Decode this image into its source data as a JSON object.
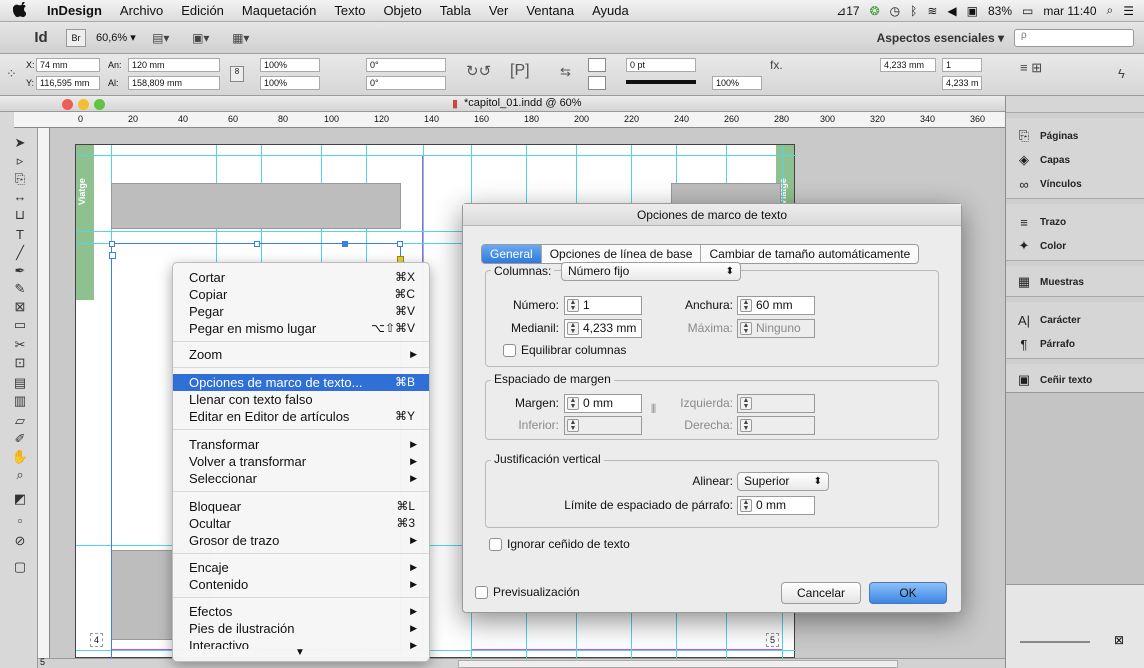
{
  "menubar": {
    "apple": "",
    "items": [
      "InDesign",
      "Archivo",
      "Edición",
      "Maquetación",
      "Texto",
      "Objeto",
      "Tabla",
      "Ver",
      "Ventana",
      "Ayuda"
    ],
    "status_badge": "17",
    "battery": "83%",
    "clock": "mar 11:40"
  },
  "appbar": {
    "logo": "Id",
    "bridge": "Br",
    "zoom": "60,6% ▾",
    "workspace": "Aspectos esenciales ▾",
    "search_placeholder": "ρ"
  },
  "control": {
    "x_label": "X:",
    "x_value": "74 mm",
    "y_label": "Y:",
    "y_value": "116,595 mm",
    "w_label": "An:",
    "w_value": "120 mm",
    "h_label": "Al:",
    "h_value": "158,809 mm",
    "scale_x": "100%",
    "scale_y": "100%",
    "angle": "0°",
    "shear": "0°",
    "stroke_weight": "0 pt",
    "opacity": "100%",
    "col_width": "4,233 mm",
    "columns": "1",
    "gutter": "4,233 m"
  },
  "document": {
    "tab_title": "*capitol_01.indd @ 60%",
    "ruler_ticks": [
      "0",
      "20",
      "40",
      "60",
      "80",
      "100",
      "120",
      "140",
      "160",
      "180",
      "200",
      "220",
      "240",
      "260",
      "280",
      "300",
      "320",
      "340",
      "360"
    ],
    "margin_label_left": "Viatge",
    "margin_label_right": "Viatge",
    "page_num_left": "4",
    "page_num_right": "5",
    "status_page": "5"
  },
  "panels": [
    {
      "icon": "pages-icon",
      "label": "Páginas"
    },
    {
      "icon": "layers-icon",
      "label": "Capas"
    },
    {
      "icon": "links-icon",
      "label": "Vínculos"
    },
    {
      "icon": "stroke-icon",
      "label": "Trazo"
    },
    {
      "icon": "color-icon",
      "label": "Color"
    },
    {
      "icon": "swatches-icon",
      "label": "Muestras"
    },
    {
      "icon": "character-icon",
      "label": "Carácter"
    },
    {
      "icon": "paragraph-icon",
      "label": "Párrafo"
    },
    {
      "icon": "text-wrap-icon",
      "label": "Ceñir texto"
    }
  ],
  "context_menu": {
    "items": [
      {
        "label": "Cortar",
        "shortcut": "⌘X"
      },
      {
        "label": "Copiar",
        "shortcut": "⌘C"
      },
      {
        "label": "Pegar",
        "shortcut": "⌘V"
      },
      {
        "label": "Pegar en mismo lugar",
        "shortcut": "⌥⇧⌘V"
      },
      {
        "label": "Zoom",
        "shortcut": "▶"
      },
      {
        "label": "Opciones de marco de texto...",
        "shortcut": "⌘B"
      },
      {
        "label": "Llenar con texto falso",
        "shortcut": ""
      },
      {
        "label": "Editar en Editor de artículos",
        "shortcut": "⌘Y"
      },
      {
        "label": "Transformar",
        "shortcut": "▶"
      },
      {
        "label": "Volver a transformar",
        "shortcut": "▶"
      },
      {
        "label": "Seleccionar",
        "shortcut": "▶"
      },
      {
        "label": "Bloquear",
        "shortcut": "⌘L"
      },
      {
        "label": "Ocultar",
        "shortcut": "⌘3"
      },
      {
        "label": "Grosor de trazo",
        "shortcut": "▶"
      },
      {
        "label": "Encaje",
        "shortcut": "▶"
      },
      {
        "label": "Contenido",
        "shortcut": "▶"
      },
      {
        "label": "Efectos",
        "shortcut": "▶"
      },
      {
        "label": "Pies de ilustración",
        "shortcut": "▶"
      },
      {
        "label": "Interactivo",
        "shortcut": "▶"
      }
    ],
    "more_arrow": "▼"
  },
  "dialog": {
    "title": "Opciones de marco de texto",
    "tabs": [
      "General",
      "Opciones de línea de base",
      "Cambiar de tamaño automáticamente"
    ],
    "columns_label": "Columnas:",
    "columns_value": "Número fijo",
    "number_label": "Número:",
    "number_value": "1",
    "width_label": "Anchura:",
    "width_value": "60 mm",
    "gutter_label": "Medianil:",
    "gutter_value": "4,233 mm",
    "max_label": "Máxima:",
    "max_value": "Ninguno",
    "balance_label": "Equilibrar columnas",
    "inset_title": "Espaciado de margen",
    "top_label": "Margen:",
    "top_value": "0 mm",
    "bottom_label": "Inferior:",
    "left_label": "Izquierda:",
    "right_label": "Derecha:",
    "vj_title": "Justificación vertical",
    "align_label": "Alinear:",
    "align_value": "Superior",
    "para_limit_label": "Límite de espaciado de párrafo:",
    "para_limit_value": "0 mm",
    "ignore_wrap_label": "Ignorar ceñido de texto",
    "preview_label": "Previsualización",
    "cancel_label": "Cancelar",
    "ok_label": "OK"
  },
  "colors": {
    "guide": "#4fd7e6",
    "margin": "#d04be0",
    "highlight": "#2f6fd6",
    "master_tab": "#8fc08f"
  }
}
